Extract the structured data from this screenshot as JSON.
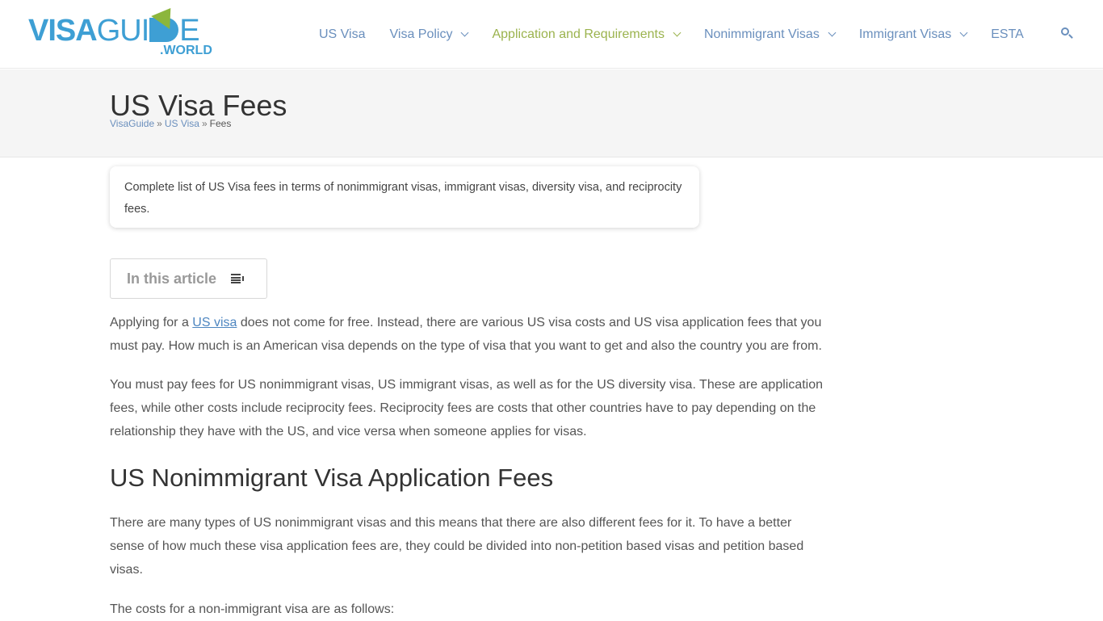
{
  "brand": {
    "logo_bold": "VISA",
    "logo_light": "GUI",
    "logo_end": "E",
    "logo_suffix": ".WORLD",
    "primary_color": "#3e9fd4",
    "accent_color": "#8cb63c"
  },
  "nav": {
    "items": [
      {
        "label": "US Visa",
        "has_dropdown": false,
        "active": false
      },
      {
        "label": "Visa Policy",
        "has_dropdown": true,
        "active": false
      },
      {
        "label": "Application and Requirements",
        "has_dropdown": true,
        "active": true
      },
      {
        "label": "Nonimmigrant Visas",
        "has_dropdown": true,
        "active": false
      },
      {
        "label": "Immigrant Visas",
        "has_dropdown": true,
        "active": false
      },
      {
        "label": "ESTA",
        "has_dropdown": false,
        "active": false
      }
    ],
    "search_icon": "search-icon",
    "link_color": "#6a8fbd",
    "active_color": "#9bb34e"
  },
  "page": {
    "title": "US Visa Fees",
    "breadcrumb": [
      {
        "label": "VisaGuide",
        "link": true
      },
      {
        "label": "US Visa",
        "link": true
      },
      {
        "label": "Fees",
        "link": false
      }
    ],
    "breadcrumb_separator": "»"
  },
  "summary": "Complete list of US Visa fees in terms of nonimmigrant visas, immigrant visas, diversity visa, and reciprocity fees.",
  "toc": {
    "label": "In this article",
    "icon": "list-toggle-icon"
  },
  "article": {
    "p1_before": "Applying for a ",
    "p1_link": "US visa",
    "p1_after": " does not come for free. Instead, there are various US visa costs and US visa application fees that you must pay. How much is an American visa depends on the type of visa that you want to get and also the country you are from.",
    "p2": "You must pay fees for US nonimmigrant visas, US immigrant visas, as well as for the US diversity visa. These are application fees, while other costs include reciprocity fees. Reciprocity fees are costs that other countries have to pay depending on the relationship they have with the US, and vice versa when someone applies for visas.",
    "h2": "US Nonimmigrant Visa Application Fees",
    "p3": "There are many types of US nonimmigrant visas and this means that there are also different fees for it. To have a better sense of how much these visa application fees are, they could be divided into non-petition based visas and petition based visas.",
    "p4": "The costs for a non-immigrant visa are as follows:"
  }
}
